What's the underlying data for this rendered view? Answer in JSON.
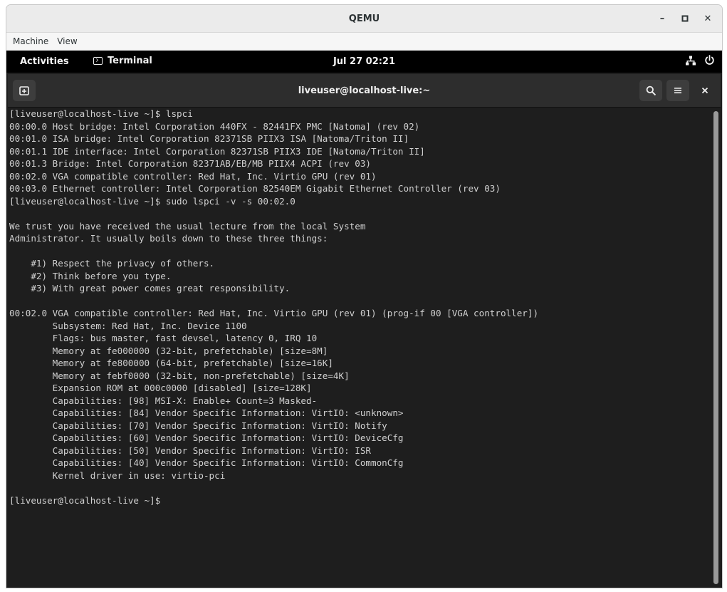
{
  "qemu": {
    "title": "QEMU",
    "menu": [
      "Machine",
      "View"
    ],
    "controls": {
      "minimize": "–",
      "maximize": "▫",
      "close": "✕"
    }
  },
  "gnome": {
    "activities": "Activities",
    "app_name": "Terminal",
    "clock": "Jul 27 02:21"
  },
  "terminal": {
    "title": "liveuser@localhost-live:~",
    "lines": [
      "[liveuser@localhost-live ~]$ lspci",
      "00:00.0 Host bridge: Intel Corporation 440FX - 82441FX PMC [Natoma] (rev 02)",
      "00:01.0 ISA bridge: Intel Corporation 82371SB PIIX3 ISA [Natoma/Triton II]",
      "00:01.1 IDE interface: Intel Corporation 82371SB PIIX3 IDE [Natoma/Triton II]",
      "00:01.3 Bridge: Intel Corporation 82371AB/EB/MB PIIX4 ACPI (rev 03)",
      "00:02.0 VGA compatible controller: Red Hat, Inc. Virtio GPU (rev 01)",
      "00:03.0 Ethernet controller: Intel Corporation 82540EM Gigabit Ethernet Controller (rev 03)",
      "[liveuser@localhost-live ~]$ sudo lspci -v -s 00:02.0",
      "",
      "We trust you have received the usual lecture from the local System",
      "Administrator. It usually boils down to these three things:",
      "",
      "    #1) Respect the privacy of others.",
      "    #2) Think before you type.",
      "    #3) With great power comes great responsibility.",
      "",
      "00:02.0 VGA compatible controller: Red Hat, Inc. Virtio GPU (rev 01) (prog-if 00 [VGA controller])",
      "        Subsystem: Red Hat, Inc. Device 1100",
      "        Flags: bus master, fast devsel, latency 0, IRQ 10",
      "        Memory at fe000000 (32-bit, prefetchable) [size=8M]",
      "        Memory at fe800000 (64-bit, prefetchable) [size=16K]",
      "        Memory at febf0000 (32-bit, non-prefetchable) [size=4K]",
      "        Expansion ROM at 000c0000 [disabled] [size=128K]",
      "        Capabilities: [98] MSI-X: Enable+ Count=3 Masked-",
      "        Capabilities: [84] Vendor Specific Information: VirtIO: <unknown>",
      "        Capabilities: [70] Vendor Specific Information: VirtIO: Notify",
      "        Capabilities: [60] Vendor Specific Information: VirtIO: DeviceCfg",
      "        Capabilities: [50] Vendor Specific Information: VirtIO: ISR",
      "        Capabilities: [40] Vendor Specific Information: VirtIO: CommonCfg",
      "        Kernel driver in use: virtio-pci",
      "",
      "[liveuser@localhost-live ~]$ "
    ]
  }
}
